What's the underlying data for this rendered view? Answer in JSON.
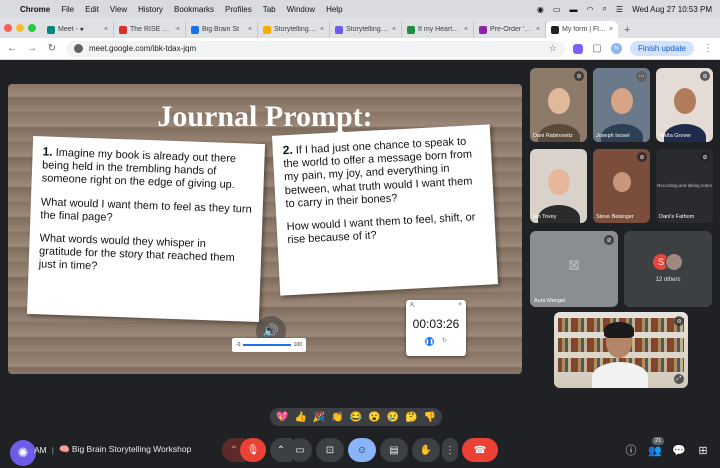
{
  "menubar": {
    "app": "Chrome",
    "items": [
      "File",
      "Edit",
      "View",
      "History",
      "Bookmarks",
      "Profiles",
      "Tab",
      "Window",
      "Help"
    ],
    "datetime": "Wed Aug 27  10:53 PM"
  },
  "tabs": [
    {
      "label": "Meet - ●",
      "color": "#00897b",
      "active": false
    },
    {
      "label": "The RISE Progr",
      "color": "#d93025",
      "active": false
    },
    {
      "label": "Big Brain St",
      "color": "#1a73e8",
      "active": false
    },
    {
      "label": "Storytelling Eve",
      "color": "#f9ab00",
      "active": false
    },
    {
      "label": "Storytelling Jou",
      "color": "#6c5ce7",
      "active": false
    },
    {
      "label": "If my Heart Co",
      "color": "#1e8e3e",
      "active": false
    },
    {
      "label": "Pre-Order 'If M",
      "color": "#8e24aa",
      "active": false
    },
    {
      "label": "My form | Floo",
      "color": "#202124",
      "active": true
    }
  ],
  "address": {
    "url": "meet.google.com/ibk-tdax-jqm",
    "profile_initial": "N",
    "finish_update": "Finish update"
  },
  "slide": {
    "title": "Journal Prompt:",
    "card1": {
      "num": "1.",
      "p1": "Imagine my book is already out there being held in the trembling hands of someone right on the edge of giving up.",
      "p2": "What would I want them to feel as they turn the final page?",
      "p3": "What words would they whisper in gratitude for the story that reached them just in time?"
    },
    "card2": {
      "num": "2.",
      "p1": "If I had just one chance to speak to the world to offer a message born from my pain, my joy, and everything in between, what truth would I want them to carry in their bones?",
      "p2": "How would I want them to feel, shift, or rise because of it?"
    },
    "volume": {
      "min": "-0",
      "max": "100"
    },
    "timer": {
      "time": "00:03:26"
    }
  },
  "participants": [
    {
      "name": "Dani Rabinowitz",
      "face": "#e0b89a",
      "body": "#5a4a3a",
      "bg": "#8d7b6a",
      "muted": true
    },
    {
      "name": "Joseph Isosel",
      "face": "#d7a486",
      "body": "#2d3f52",
      "bg": "#6b7a8a",
      "muted": false,
      "speaking": true
    },
    {
      "name": "Nikita Grover",
      "face": "#b07c5c",
      "body": "#1f2b4a",
      "bg": "#e4dcd4",
      "muted": true
    },
    {
      "name": "Ian Tovey",
      "face": "#e6b79d",
      "body": "#2b2b2b",
      "bg": "#d8d2ca",
      "muted": false
    },
    {
      "name": "Steve Belanger",
      "face": "#c9967a",
      "body": "#402f27",
      "bg": "#7a4e3a",
      "muted": true
    },
    {
      "name": "Dani's Fathom",
      "face": "#3c4043",
      "body": "#3c4043",
      "bg": "#2a2b2e",
      "muted": true,
      "note": "Recording and taking notes"
    }
  ],
  "aura": {
    "name": "Aura Mengel"
  },
  "others": {
    "initial": "S",
    "label": "12 others"
  },
  "emojis": [
    "💖",
    "👍",
    "🎉",
    "👏",
    "😂",
    "😮",
    "😢",
    "🤔",
    "👎"
  ],
  "controls": {
    "time": "AM",
    "meeting_name": "🧠 Big Brain Storytelling Workshop",
    "people_count": "21"
  }
}
